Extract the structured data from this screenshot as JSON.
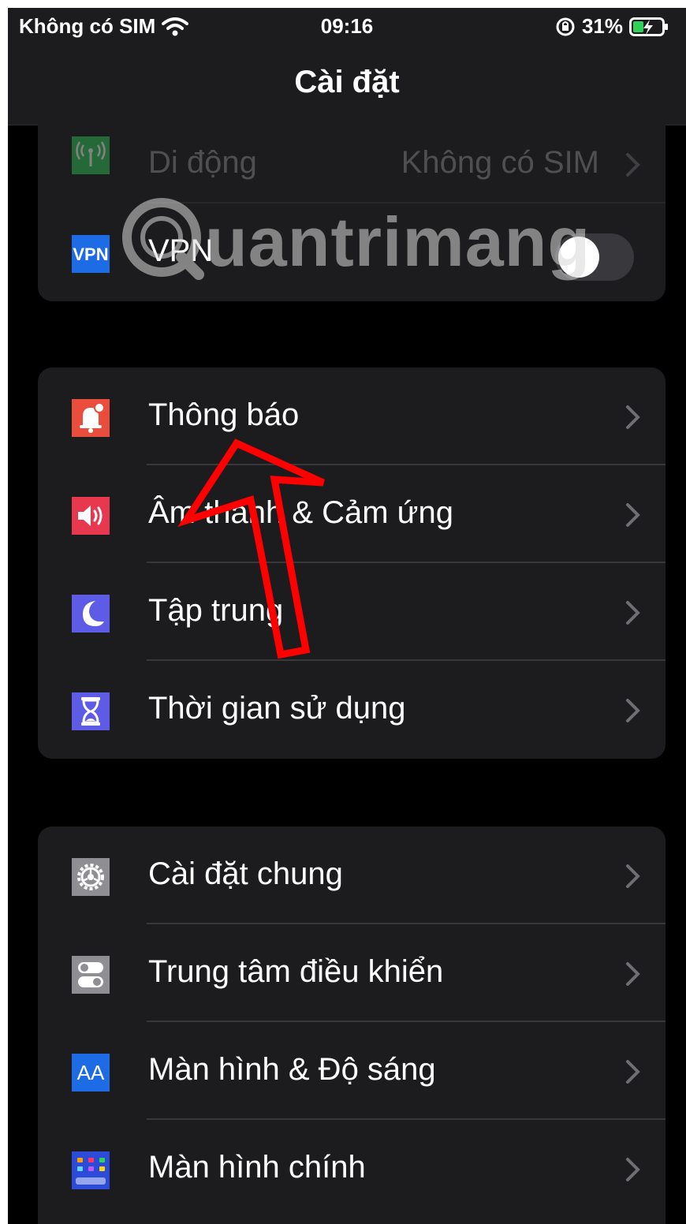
{
  "status_bar": {
    "carrier": "Không có SIM",
    "time": "09:16",
    "battery": "31%"
  },
  "nav": {
    "title": "Cài đặt"
  },
  "groups": [
    {
      "rows": [
        {
          "label": "Di động",
          "value": "Không có SIM",
          "icon": "antenna-icon",
          "color": "#34c759"
        },
        {
          "label": "VPN",
          "icon": "vpn-icon",
          "color": "#1e6be6",
          "toggle": false
        }
      ]
    },
    {
      "rows": [
        {
          "label": "Thông báo",
          "icon": "bell-icon",
          "color": "#eb4d3d"
        },
        {
          "label": "Âm thanh & Cảm ứng",
          "icon": "speaker-icon",
          "color": "#e8384f"
        },
        {
          "label": "Tập trung",
          "icon": "moon-icon",
          "color": "#5e5ce6"
        },
        {
          "label": "Thời gian sử dụng",
          "icon": "hourglass-icon",
          "color": "#5e5ce6"
        }
      ]
    },
    {
      "rows": [
        {
          "label": "Cài đặt chung",
          "icon": "gear-icon",
          "color": "#8e8e93"
        },
        {
          "label": "Trung tâm điều khiển",
          "icon": "switches-icon",
          "color": "#8e8e93"
        },
        {
          "label": "Màn hình & Độ sáng",
          "icon": "aa-icon",
          "icon_text": "AA",
          "color": "#1e6be6"
        },
        {
          "label": "Màn hình chính",
          "icon": "home-grid-icon",
          "color": "#2c4bd8"
        }
      ]
    }
  ],
  "watermark": {
    "text": "uantrimang"
  },
  "annotation": {
    "color": "#ff0000"
  }
}
